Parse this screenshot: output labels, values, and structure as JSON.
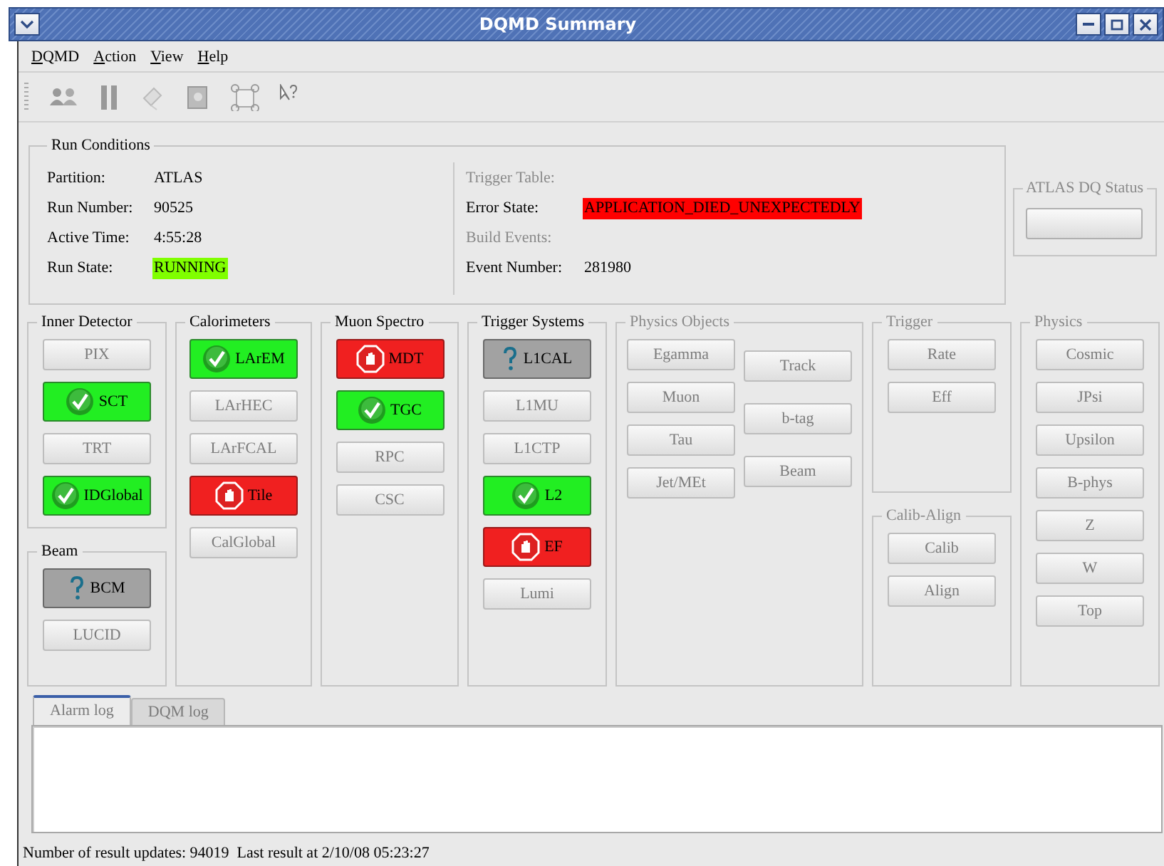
{
  "window": {
    "title": "DQMD Summary"
  },
  "menu": [
    {
      "label": "DQMD"
    },
    {
      "label": "Action"
    },
    {
      "label": "View"
    },
    {
      "label": "Help"
    }
  ],
  "run_conditions": {
    "title": "Run Conditions",
    "left": [
      {
        "label": "Partition:",
        "value": "ATLAS",
        "disabled": false
      },
      {
        "label": "Run Number:",
        "value": "90525",
        "disabled": false
      },
      {
        "label": "Active Time:",
        "value": "4:55:28",
        "disabled": false
      },
      {
        "label": "Run State:",
        "value": "RUNNING",
        "color": "#80ff00",
        "disabled": false
      }
    ],
    "right": [
      {
        "label": "Trigger Table:",
        "disabled": true
      },
      {
        "label": "Error State:",
        "value": "APPLICATION_DIED_UNEXPECTEDLY",
        "color": "#ff0000",
        "disabled": false
      },
      {
        "label": "Build Events:",
        "disabled": true
      },
      {
        "label": "Event Number:",
        "value": "281980",
        "disabled": false
      }
    ]
  },
  "dq_status": {
    "title": "ATLAS DQ Status",
    "disabled": true
  },
  "panels": [
    {
      "groups": [
        {
          "title": "Inner Detector",
          "disabled": false,
          "button_columns": [
            [
              {
                "label": "PIX",
                "kind": "none"
              },
              {
                "label": "SCT",
                "kind": "good"
              },
              {
                "label": "TRT",
                "kind": "none"
              },
              {
                "label": "IDGlobal",
                "kind": "good"
              }
            ]
          ]
        },
        {
          "title": "Beam",
          "disabled": false,
          "button_columns": [
            [
              {
                "label": "BCM",
                "kind": "unknown"
              },
              {
                "label": "LUCID",
                "kind": "none"
              }
            ]
          ]
        }
      ]
    },
    {
      "groups": [
        {
          "title": "Calorimeters",
          "disabled": false,
          "button_columns": [
            [
              {
                "label": "LArEM",
                "kind": "good"
              },
              {
                "label": "LArHEC",
                "kind": "none"
              },
              {
                "label": "LArFCAL",
                "kind": "none"
              },
              {
                "label": "Tile",
                "kind": "bad"
              },
              {
                "label": "CalGlobal",
                "kind": "none"
              }
            ]
          ]
        }
      ]
    },
    {
      "groups": [
        {
          "title": "Muon Spectro",
          "disabled": false,
          "button_columns": [
            [
              {
                "label": "MDT",
                "kind": "bad"
              },
              {
                "label": "TGC",
                "kind": "good"
              },
              {
                "label": "RPC",
                "kind": "none"
              },
              {
                "label": "CSC",
                "kind": "none"
              }
            ]
          ]
        }
      ]
    },
    {
      "groups": [
        {
          "title": "Trigger Systems",
          "disabled": false,
          "button_columns": [
            [
              {
                "label": "L1CAL",
                "kind": "unknown"
              },
              {
                "label": "L1MU",
                "kind": "none"
              },
              {
                "label": "L1CTP",
                "kind": "none"
              },
              {
                "label": "L2",
                "kind": "good"
              },
              {
                "label": "EF",
                "kind": "bad"
              },
              {
                "label": "Lumi",
                "kind": "none"
              }
            ]
          ]
        }
      ]
    },
    {
      "groups": [
        {
          "title": "Physics Objects",
          "disabled": true,
          "button_columns": [
            [
              {
                "label": "Egamma",
                "kind": "none"
              },
              {
                "label": "Muon",
                "kind": "none"
              },
              {
                "label": "Tau",
                "kind": "none"
              },
              {
                "label": "Jet/MEt",
                "kind": "none"
              }
            ],
            [
              {
                "label": "Track",
                "kind": "none"
              },
              {
                "label": "b-tag",
                "kind": "none"
              },
              {
                "label": "Beam",
                "kind": "none"
              }
            ]
          ]
        }
      ]
    },
    {
      "groups": [
        {
          "title": "Trigger",
          "disabled": true,
          "button_columns": [
            [
              {
                "label": "Rate",
                "kind": "none"
              },
              {
                "label": "Eff",
                "kind": "none"
              }
            ]
          ]
        },
        {
          "title": "Calib-Align",
          "disabled": true,
          "button_columns": [
            [
              {
                "label": "Calib",
                "kind": "none"
              },
              {
                "label": "Align",
                "kind": "none"
              }
            ]
          ]
        }
      ]
    },
    {
      "groups": [
        {
          "title": "Physics",
          "disabled": true,
          "button_columns": [
            [
              {
                "label": "Cosmic",
                "kind": "none"
              },
              {
                "label": "JPsi",
                "kind": "none"
              },
              {
                "label": "Upsilon",
                "kind": "none"
              },
              {
                "label": "B-phys",
                "kind": "none"
              },
              {
                "label": "Z",
                "kind": "none"
              },
              {
                "label": "W",
                "kind": "none"
              },
              {
                "label": "Top",
                "kind": "none"
              }
            ]
          ]
        }
      ]
    }
  ],
  "log": {
    "tabs": [
      {
        "label": "Alarm log",
        "selected": true
      },
      {
        "label": "DQM log",
        "selected": false
      }
    ]
  },
  "status_bar": {
    "text": "Number of result updates: 94019  Last result at 2/10/08 05:23:27"
  }
}
